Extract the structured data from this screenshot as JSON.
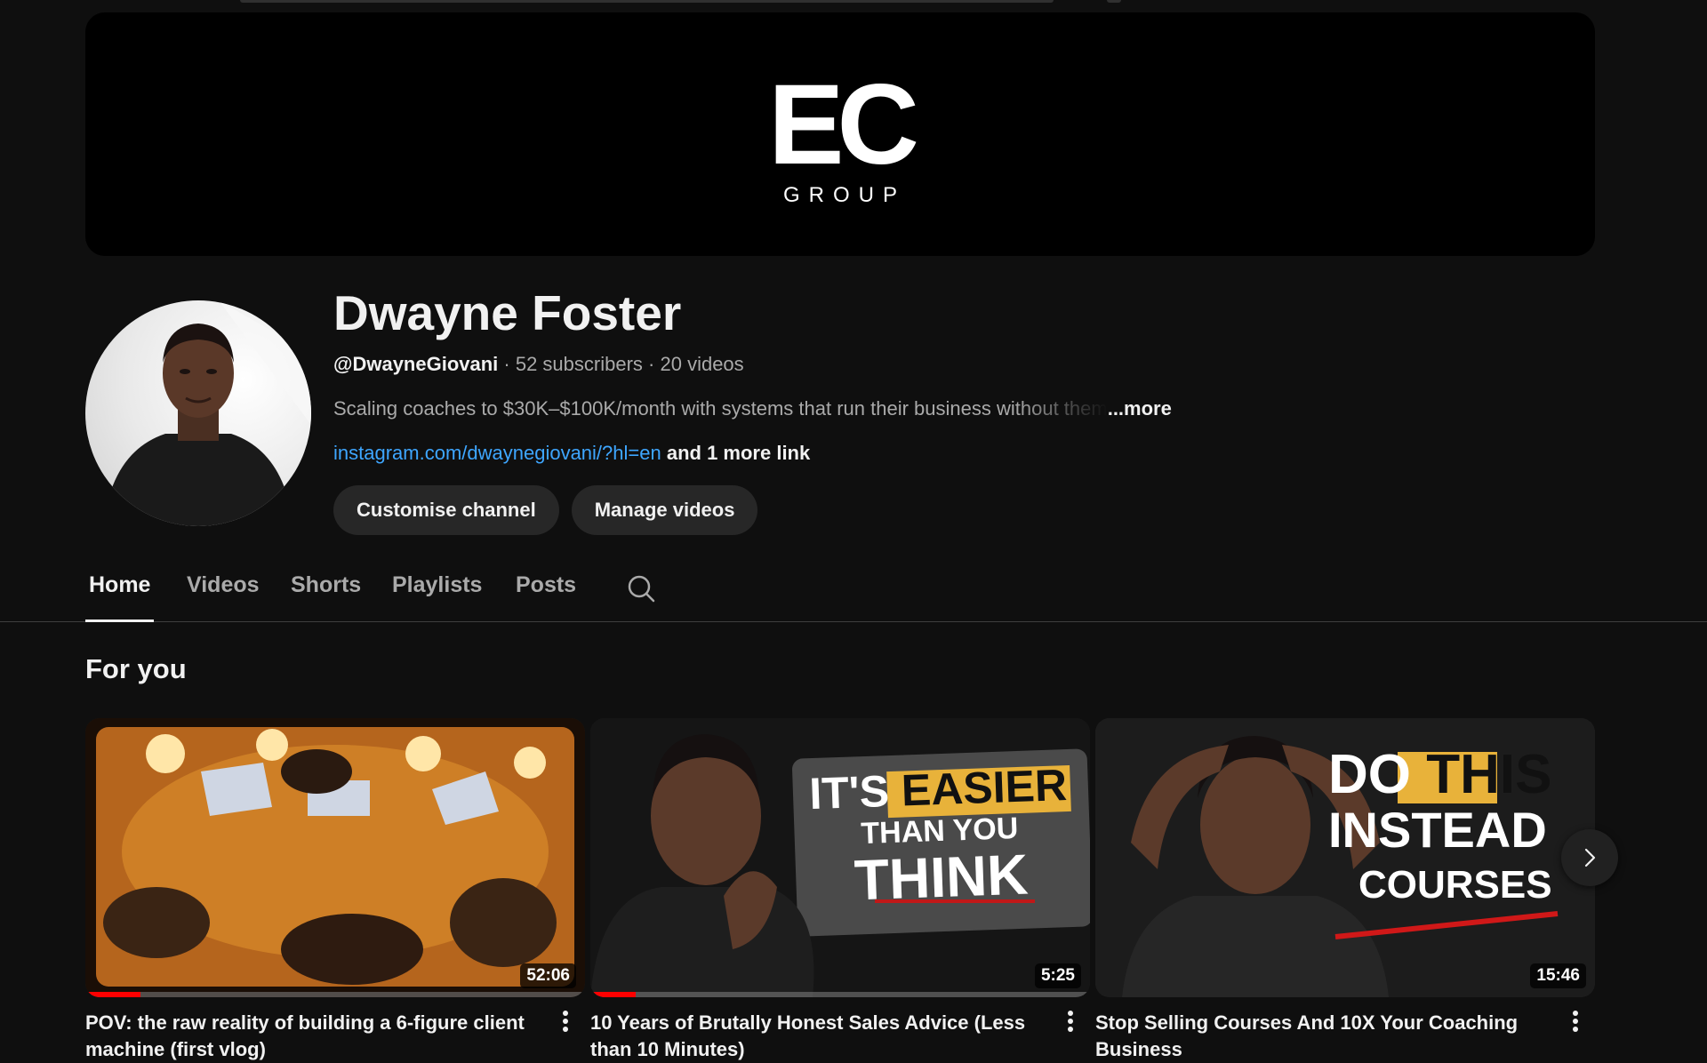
{
  "banner": {
    "logo_mark": "EC",
    "logo_sub": "GROUP"
  },
  "channel": {
    "name": "Dwayne Foster",
    "handle": "@DwayneGiovani",
    "subscribers": "52 subscribers",
    "videos": "20 videos",
    "separator": " · ",
    "description": "Scaling coaches to $30K–$100K/month with systems that run their business without them",
    "more_label": "...more",
    "link_url": "instagram.com/dwaynegiovani/?hl=en",
    "more_links": "and 1 more link"
  },
  "buttons": {
    "customise": "Customise channel",
    "manage": "Manage videos"
  },
  "tabs": [
    {
      "label": "Home",
      "active": true
    },
    {
      "label": "Videos",
      "active": false
    },
    {
      "label": "Shorts",
      "active": false
    },
    {
      "label": "Playlists",
      "active": false
    },
    {
      "label": "Posts",
      "active": false
    }
  ],
  "section": {
    "title": "For you"
  },
  "videos": [
    {
      "title": "POV: the raw reality of building a 6-figure client machine (first vlog)",
      "duration": "52:06",
      "watched_fraction": 0.11
    },
    {
      "title": "10 Years of Brutally Honest Sales Advice (Less than 10 Minutes)",
      "duration": "5:25",
      "watched_fraction": 0.09,
      "thumb_text": [
        "IT'S",
        "EASIER",
        "THAN YOU",
        "THINK"
      ]
    },
    {
      "title": "Stop Selling Courses And 10X Your Coaching Business",
      "duration": "15:46",
      "watched_fraction": 0,
      "thumb_text": [
        "DO",
        "THIS",
        "INSTEAD",
        "COURSES"
      ]
    }
  ],
  "colors": {
    "background": "#0f0f0f",
    "link": "#3ea6ff",
    "progress": "#ff0000",
    "button_bg": "#272727"
  }
}
